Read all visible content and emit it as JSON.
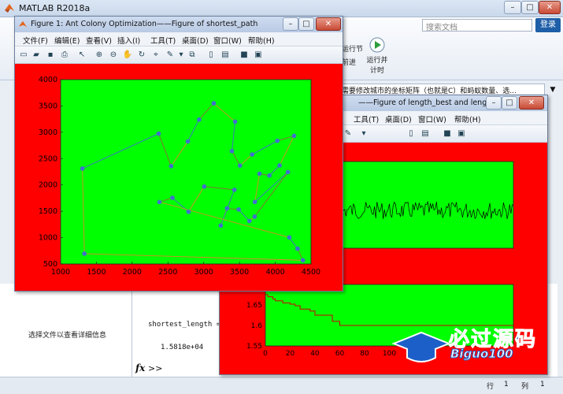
{
  "matlab": {
    "title": "MATLAB R2018a",
    "search_placeholder": "搜索文档",
    "login_label": "登录",
    "ribbon": {
      "run_section_label": "运行节",
      "advance_label": "前进",
      "run_time_label": "运行并\n计时"
    },
    "path_text": "需要修改城市的坐标矩阵（也就是C）和蚂蚁数量、选...",
    "details_text": "选择文件以查看详细信息",
    "command": {
      "variable_line": "shortest_length =",
      "value_line": "1.5818e+04",
      "fx_symbol": "fx",
      "prompt": ">>"
    },
    "status": {
      "row_label": "行",
      "row_value": "1",
      "col_label": "列",
      "col_value": "1"
    }
  },
  "figure1": {
    "title": "Figure 1: Ant Colony Optimization——Figure of shortest_path",
    "menu": [
      "文件(F)",
      "编辑(E)",
      "查看(V)",
      "插入(I)",
      "工具(T)",
      "桌面(D)",
      "窗口(W)",
      "帮助(H)"
    ],
    "colors": {
      "canvas": "#ff0000",
      "axes": "#00ff00",
      "point": "#3f6fcf"
    }
  },
  "figure2": {
    "title": "——Figure of length_best and length_a...",
    "menu": [
      "工具(T)",
      "桌面(D)",
      "窗口(W)",
      "帮助(H)"
    ],
    "colors": {
      "canvas": "#ff0000",
      "axes": "#00ff00"
    }
  },
  "watermark": {
    "cn": "必过源码",
    "en": "Biguo100"
  },
  "chart_data": [
    {
      "type": "line",
      "title": "",
      "xlabel": "",
      "ylabel": "",
      "xlim": [
        1000,
        4500
      ],
      "ylim": [
        500,
        4000
      ],
      "xticks": [
        1000,
        1500,
        2000,
        2500,
        3000,
        3500,
        4000,
        4500
      ],
      "yticks": [
        500,
        1000,
        1500,
        2000,
        2500,
        3000,
        3500,
        4000
      ],
      "grid": false,
      "points": [
        [
          1304,
          2312
        ],
        [
          3639,
          1315
        ],
        [
          4177,
          2244
        ],
        [
          3712,
          1399
        ],
        [
          3488,
          1535
        ],
        [
          3326,
          1556
        ],
        [
          3238,
          1229
        ],
        [
          4196,
          1004
        ],
        [
          4312,
          790
        ],
        [
          4386,
          570
        ],
        [
          3007,
          1970
        ],
        [
          2562,
          1756
        ],
        [
          2788,
          1491
        ],
        [
          2381,
          1676
        ],
        [
          1332,
          695
        ],
        [
          3715,
          1678
        ],
        [
          3918,
          2179
        ],
        [
          4061,
          2370
        ],
        [
          3780,
          2212
        ],
        [
          3676,
          2578
        ],
        [
          4029,
          2838
        ],
        [
          4263,
          2931
        ],
        [
          3429,
          1908
        ],
        [
          3507,
          2367
        ],
        [
          3394,
          2643
        ],
        [
          3439,
          3201
        ],
        [
          2935,
          3240
        ],
        [
          3140,
          3550
        ],
        [
          2545,
          2357
        ],
        [
          2778,
          2826
        ],
        [
          2370,
          2975
        ]
      ],
      "route_order": [
        14,
        0,
        30,
        28,
        29,
        26,
        27,
        25,
        24,
        23,
        19,
        20,
        21,
        17,
        16,
        18,
        15,
        2,
        3,
        1,
        4,
        5,
        6,
        22,
        10,
        12,
        11,
        13,
        7,
        8,
        9
      ]
    },
    {
      "type": "line",
      "title": "",
      "xlabel": "",
      "ylabel": "",
      "xlim": [
        0,
        200
      ],
      "ylim": [
        1.55,
        1.7
      ],
      "xticks": [
        0,
        20,
        40,
        60,
        80,
        100
      ],
      "yticks": [
        1.55,
        1.6,
        1.65
      ],
      "grid": false,
      "series": [
        {
          "name": "",
          "color": "#cc0000",
          "x": [
            0,
            2,
            6,
            8,
            14,
            20,
            24,
            28,
            36,
            40,
            54,
            60,
            100,
            140,
            200
          ],
          "y": [
            1.675,
            1.67,
            1.665,
            1.66,
            1.655,
            1.652,
            1.648,
            1.64,
            1.635,
            1.625,
            1.61,
            1.6,
            1.6,
            1.6,
            1.6
          ]
        },
        {
          "name": "",
          "color": "#000000",
          "x": [
            0,
            200
          ],
          "y": [
            1.75,
            1.75
          ]
        }
      ]
    }
  ]
}
